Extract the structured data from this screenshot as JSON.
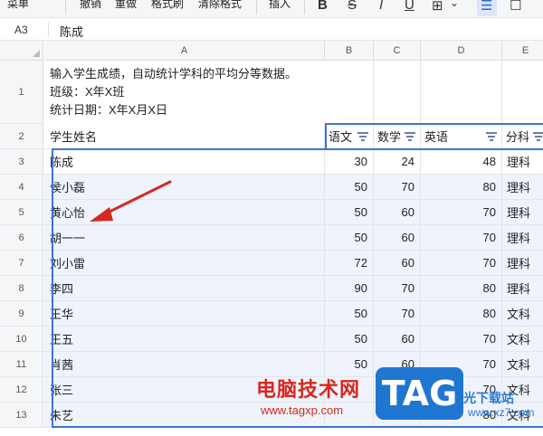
{
  "toolbar": {
    "menu": "菜单",
    "undo": "撤销",
    "redo": "重做",
    "format_painter": "格式刷",
    "clear_format": "清除格式",
    "insert": "插入",
    "bold_glyph": "B",
    "strike_glyph": "S",
    "italic_glyph": "I",
    "underline_glyph": "U",
    "border_glyph": "⊞",
    "chevron": "⌄",
    "align_glyph": "☰",
    "close_glyph": "☐"
  },
  "formula_bar": {
    "cell_ref": "A3",
    "value": "陈成"
  },
  "columns": [
    "A",
    "B",
    "C",
    "D",
    "E"
  ],
  "rows": [
    "1",
    "2",
    "3",
    "4",
    "5",
    "6",
    "7",
    "8",
    "9",
    "10",
    "11",
    "12",
    "13"
  ],
  "title_lines": [
    "输入学生成绩，自动统计学科的平均分等数据。",
    "班级：X年X班",
    "统计日期：X年X月X日"
  ],
  "header": {
    "name": "学生姓名",
    "chinese": "语文",
    "math": "数学",
    "english": "英语",
    "subject": "分科"
  },
  "students": [
    {
      "name": "陈成",
      "chinese": "30",
      "math": "24",
      "english": "48",
      "subject": "理科"
    },
    {
      "name": "侯小磊",
      "chinese": "50",
      "math": "70",
      "english": "80",
      "subject": "理科"
    },
    {
      "name": "黄心怡",
      "chinese": "50",
      "math": "60",
      "english": "70",
      "subject": "理科"
    },
    {
      "name": "胡一一",
      "chinese": "50",
      "math": "60",
      "english": "70",
      "subject": "理科"
    },
    {
      "name": "刘小雷",
      "chinese": "72",
      "math": "60",
      "english": "70",
      "subject": "理科"
    },
    {
      "name": "李四",
      "chinese": "90",
      "math": "70",
      "english": "80",
      "subject": "理科"
    },
    {
      "name": "王华",
      "chinese": "50",
      "math": "70",
      "english": "80",
      "subject": "文科"
    },
    {
      "name": "王五",
      "chinese": "50",
      "math": "60",
      "english": "70",
      "subject": "文科"
    },
    {
      "name": "肖茜",
      "chinese": "50",
      "math": "60",
      "english": "70",
      "subject": "文科"
    },
    {
      "name": "张三",
      "chinese": "",
      "math": "",
      "english": "70",
      "subject": "文科"
    },
    {
      "name": "朱艺",
      "chinese": "",
      "math": "",
      "english": "80",
      "subject": "文科"
    }
  ],
  "watermark": {
    "cn": "电脑技术网",
    "url": "www.tagxp.com",
    "tag": "TAG",
    "site_cn": "光下载站",
    "site_url": "www.xz7.com"
  },
  "colors": {
    "selection": "#3f74d4",
    "arrow": "#d42a22",
    "watermark_red": "#d7281e",
    "tag_blue": "#1f76d0"
  }
}
